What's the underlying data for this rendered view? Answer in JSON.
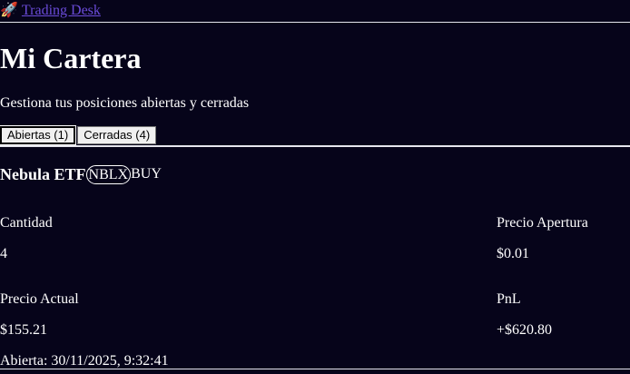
{
  "nav": {
    "icon": "rocket-icon",
    "icon_glyph": "🚀",
    "link_label": "Trading Desk"
  },
  "page": {
    "title": "Mi Cartera",
    "subtitle": "Gestiona tus posiciones abiertas y cerradas"
  },
  "tabs": [
    {
      "label": "Abiertas (1)",
      "active": true
    },
    {
      "label": "Cerradas (4)",
      "active": false
    }
  ],
  "position": {
    "name": "Nebula ETF",
    "ticker": "NBLX",
    "side": "BUY",
    "quantity_label": "Cantidad",
    "quantity_value": "4",
    "open_price_label": "Precio Apertura",
    "open_price_value": "$0.01",
    "current_price_label": "Precio Actual",
    "current_price_value": "$155.21",
    "pnl_label": "PnL",
    "pnl_value": "+$620.80",
    "opened_at": "Abierta: 30/11/2025, 9:32:41"
  },
  "colors": {
    "background": "#06041a",
    "text": "#ffffff",
    "link": "#6a4bd8"
  }
}
